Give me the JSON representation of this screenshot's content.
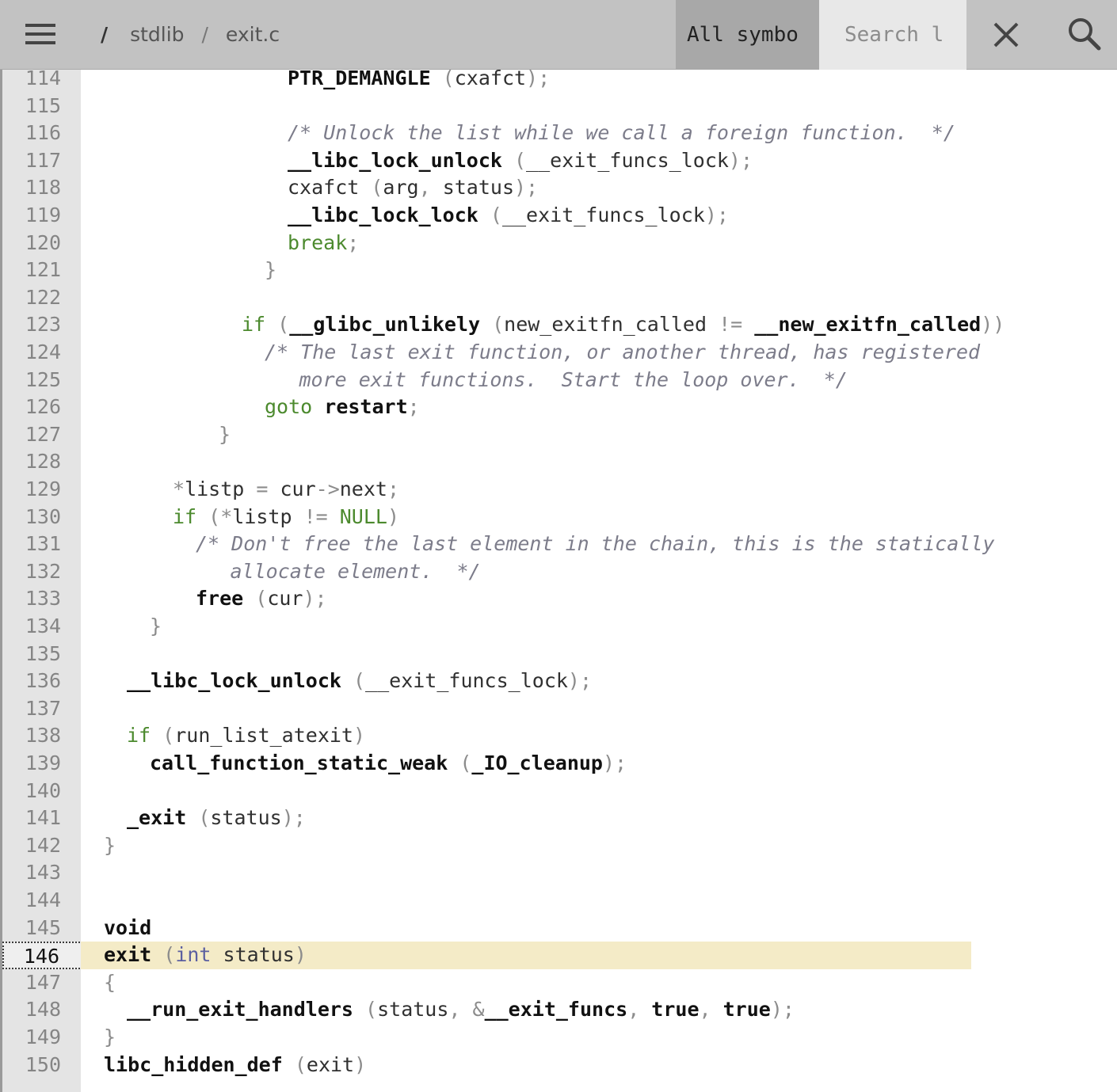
{
  "header": {
    "breadcrumb": {
      "root": "/",
      "segments": [
        "stdlib",
        "exit.c"
      ],
      "separator": "/"
    },
    "symbols_select": {
      "value": "All symbo"
    },
    "search": {
      "placeholder": "Search lo",
      "value": ""
    },
    "icons": {
      "menu": "hamburger-menu-icon",
      "close": "close-icon",
      "search": "search-icon"
    }
  },
  "editor": {
    "selected_line": 146,
    "highlight_color": "#f4ebc7",
    "syntax_colors": {
      "keyword": "#4c8a2e",
      "type": "#5b5fa0",
      "comment": "#7c7c8a",
      "punct": "#8c8c8c",
      "symbol": "#111111"
    },
    "lines": [
      {
        "n": "114",
        "indent": 8,
        "tokens": [
          [
            "sym",
            "PTR_DEMANGLE"
          ],
          [
            "p",
            " ("
          ],
          [
            "id",
            "cxafct"
          ],
          [
            "p",
            ");"
          ]
        ]
      },
      {
        "n": "115",
        "indent": 0,
        "tokens": []
      },
      {
        "n": "116",
        "indent": 8,
        "tokens": [
          [
            "cm",
            "/* Unlock the list while we call a foreign function.  */"
          ]
        ]
      },
      {
        "n": "117",
        "indent": 8,
        "tokens": [
          [
            "sym",
            "__libc_lock_unlock"
          ],
          [
            "p",
            " ("
          ],
          [
            "id",
            "__exit_funcs_lock"
          ],
          [
            "p",
            ");"
          ]
        ]
      },
      {
        "n": "118",
        "indent": 8,
        "tokens": [
          [
            "id",
            "cxafct"
          ],
          [
            "p",
            " ("
          ],
          [
            "id",
            "arg"
          ],
          [
            "p",
            ", "
          ],
          [
            "id",
            "status"
          ],
          [
            "p",
            ");"
          ]
        ]
      },
      {
        "n": "119",
        "indent": 8,
        "tokens": [
          [
            "sym",
            "__libc_lock_lock"
          ],
          [
            "p",
            " ("
          ],
          [
            "id",
            "__exit_funcs_lock"
          ],
          [
            "p",
            ");"
          ]
        ]
      },
      {
        "n": "120",
        "indent": 8,
        "tokens": [
          [
            "kw",
            "break"
          ],
          [
            "p",
            ";"
          ]
        ]
      },
      {
        "n": "121",
        "indent": 7,
        "tokens": [
          [
            "p",
            "}"
          ]
        ]
      },
      {
        "n": "122",
        "indent": 0,
        "tokens": []
      },
      {
        "n": "123",
        "indent": 6,
        "tokens": [
          [
            "kw",
            "if"
          ],
          [
            "p",
            " ("
          ],
          [
            "sym",
            "__glibc_unlikely"
          ],
          [
            "p",
            " ("
          ],
          [
            "id",
            "new_exitfn_called"
          ],
          [
            "p",
            " != "
          ],
          [
            "sym",
            "__new_exitfn_called"
          ],
          [
            "p",
            "))"
          ]
        ]
      },
      {
        "n": "124",
        "indent": 7,
        "tokens": [
          [
            "cm",
            "/* The last exit function, or another thread, has registered"
          ]
        ]
      },
      {
        "n": "125",
        "indent": 8.5,
        "tokens": [
          [
            "cm",
            "more exit functions.  Start the loop over.  */"
          ]
        ]
      },
      {
        "n": "126",
        "indent": 7,
        "tokens": [
          [
            "kw",
            "goto"
          ],
          [
            "p",
            " "
          ],
          [
            "sym",
            "restart"
          ],
          [
            "p",
            ";"
          ]
        ]
      },
      {
        "n": "127",
        "indent": 5,
        "tokens": [
          [
            "p",
            "}"
          ]
        ]
      },
      {
        "n": "128",
        "indent": 0,
        "tokens": []
      },
      {
        "n": "129",
        "indent": 3,
        "tokens": [
          [
            "p",
            "*"
          ],
          [
            "id",
            "listp"
          ],
          [
            "p",
            " = "
          ],
          [
            "id",
            "cur"
          ],
          [
            "p",
            "->"
          ],
          [
            "id",
            "next"
          ],
          [
            "p",
            ";"
          ]
        ]
      },
      {
        "n": "130",
        "indent": 3,
        "tokens": [
          [
            "kw",
            "if"
          ],
          [
            "p",
            " (*"
          ],
          [
            "id",
            "listp"
          ],
          [
            "p",
            " != "
          ],
          [
            "kw",
            "NULL"
          ],
          [
            "p",
            ")"
          ]
        ]
      },
      {
        "n": "131",
        "indent": 4,
        "tokens": [
          [
            "cm",
            "/* Don't free the last element in the chain, this is the statically"
          ]
        ]
      },
      {
        "n": "132",
        "indent": 5.5,
        "tokens": [
          [
            "cm",
            "allocate element.  */"
          ]
        ]
      },
      {
        "n": "133",
        "indent": 4,
        "tokens": [
          [
            "sym",
            "free"
          ],
          [
            "p",
            " ("
          ],
          [
            "id",
            "cur"
          ],
          [
            "p",
            ");"
          ]
        ]
      },
      {
        "n": "134",
        "indent": 2,
        "tokens": [
          [
            "p",
            "}"
          ]
        ]
      },
      {
        "n": "135",
        "indent": 0,
        "tokens": []
      },
      {
        "n": "136",
        "indent": 1,
        "tokens": [
          [
            "sym",
            "__libc_lock_unlock"
          ],
          [
            "p",
            " ("
          ],
          [
            "id",
            "__exit_funcs_lock"
          ],
          [
            "p",
            ");"
          ]
        ]
      },
      {
        "n": "137",
        "indent": 0,
        "tokens": []
      },
      {
        "n": "138",
        "indent": 1,
        "tokens": [
          [
            "kw",
            "if"
          ],
          [
            "p",
            " ("
          ],
          [
            "id",
            "run_list_atexit"
          ],
          [
            "p",
            ")"
          ]
        ]
      },
      {
        "n": "139",
        "indent": 2,
        "tokens": [
          [
            "sym",
            "call_function_static_weak"
          ],
          [
            "p",
            " ("
          ],
          [
            "sym",
            "_IO_cleanup"
          ],
          [
            "p",
            ");"
          ]
        ]
      },
      {
        "n": "140",
        "indent": 0,
        "tokens": []
      },
      {
        "n": "141",
        "indent": 1,
        "tokens": [
          [
            "sym",
            "_exit"
          ],
          [
            "p",
            " ("
          ],
          [
            "id",
            "status"
          ],
          [
            "p",
            ");"
          ]
        ]
      },
      {
        "n": "142",
        "indent": 0,
        "tokens": [
          [
            "p",
            "}"
          ]
        ]
      },
      {
        "n": "143",
        "indent": 0,
        "tokens": []
      },
      {
        "n": "144",
        "indent": 0,
        "tokens": []
      },
      {
        "n": "145",
        "indent": 0,
        "tokens": [
          [
            "sym",
            "void"
          ]
        ]
      },
      {
        "n": "146",
        "indent": 0,
        "tokens": [
          [
            "sym",
            "exit"
          ],
          [
            "p",
            " ("
          ],
          [
            "type",
            "int"
          ],
          [
            "p",
            " "
          ],
          [
            "id",
            "status"
          ],
          [
            "p",
            ")"
          ]
        ]
      },
      {
        "n": "147",
        "indent": 0,
        "tokens": [
          [
            "p",
            "{"
          ]
        ]
      },
      {
        "n": "148",
        "indent": 1,
        "tokens": [
          [
            "sym",
            "__run_exit_handlers"
          ],
          [
            "p",
            " ("
          ],
          [
            "id",
            "status"
          ],
          [
            "p",
            ", &"
          ],
          [
            "sym",
            "__exit_funcs"
          ],
          [
            "p",
            ", "
          ],
          [
            "sym",
            "true"
          ],
          [
            "p",
            ", "
          ],
          [
            "sym",
            "true"
          ],
          [
            "p",
            ");"
          ]
        ]
      },
      {
        "n": "149",
        "indent": 0,
        "tokens": [
          [
            "p",
            "}"
          ]
        ]
      },
      {
        "n": "150",
        "indent": 0,
        "tokens": [
          [
            "sym",
            "libc_hidden_def"
          ],
          [
            "p",
            " ("
          ],
          [
            "id",
            "exit"
          ],
          [
            "p",
            ")"
          ]
        ]
      }
    ]
  }
}
